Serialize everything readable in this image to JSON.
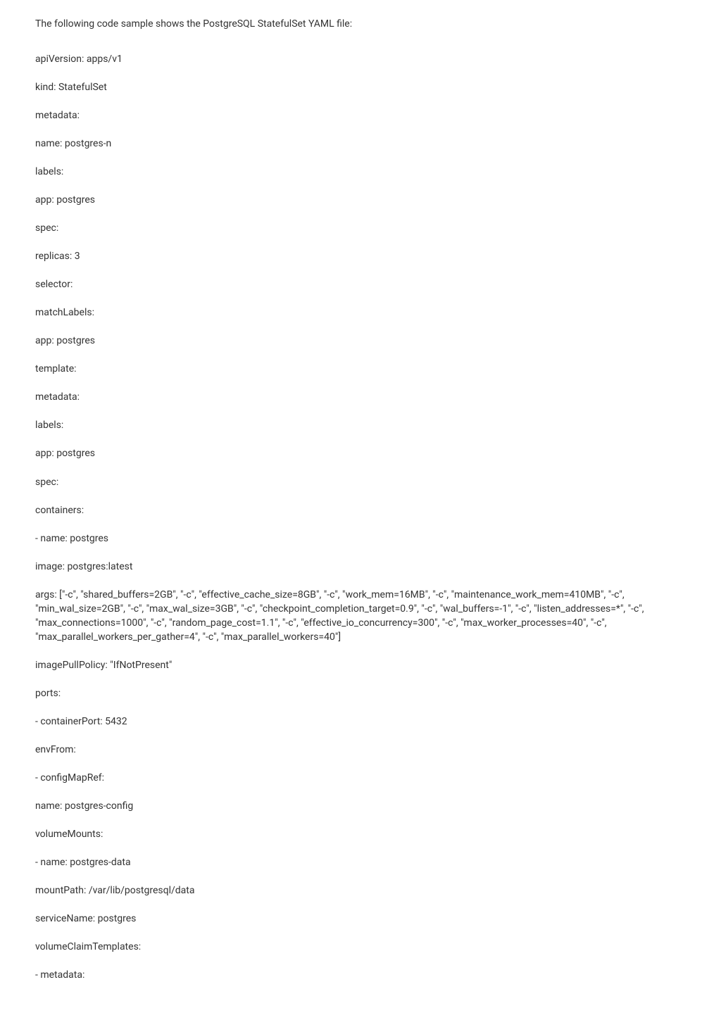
{
  "intro": "The following code sample shows the PostgreSQL StatefulSet YAML file:",
  "code": {
    "l1": "apiVersion: apps/v1",
    "l2": "kind: StatefulSet",
    "l3": "metadata:",
    "l4": "name: postgres-n",
    "l5": "labels:",
    "l6": "app: postgres",
    "l7": "spec:",
    "l8": "replicas: 3",
    "l9": "selector:",
    "l10": "matchLabels:",
    "l11": "app: postgres",
    "l12": "template:",
    "l13": "metadata:",
    "l14": "labels:",
    "l15": "app: postgres",
    "l16": "spec:",
    "l17": "containers:",
    "l18": "- name: postgres",
    "l19": "image: postgres:latest",
    "l20": "args: [\"-c\", \"shared_buffers=2GB\", \"-c\", \"effective_cache_size=8GB\", \"-c\", \"work_mem=16MB\", \"-c\", \"maintenance_work_mem=410MB\", \"-c\", \"min_wal_size=2GB\", \"-c\", \"max_wal_size=3GB\", \"-c\", \"checkpoint_completion_target=0.9\", \"-c\", \"wal_buffers=-1\", \"-c\", \"listen_addresses=*\", \"-c\", \"max_connections=1000\", \"-c\", \"random_page_cost=1.1\", \"-c\", \"effective_io_concurrency=300\", \"-c\", \"max_worker_processes=40\", \"-c\", \"max_parallel_workers_per_gather=4\", \"-c\", \"max_parallel_workers=40\"]",
    "l21": "imagePullPolicy: \"IfNotPresent\"",
    "l22": "ports:",
    "l23": "- containerPort: 5432",
    "l24": "envFrom:",
    "l25": "- configMapRef:",
    "l26": "name: postgres-config",
    "l27": "volumeMounts:",
    "l28": "- name: postgres-data",
    "l29": "mountPath: /var/lib/postgresql/data",
    "l30": "serviceName: postgres",
    "l31": "volumeClaimTemplates:",
    "l32": "- metadata:"
  }
}
